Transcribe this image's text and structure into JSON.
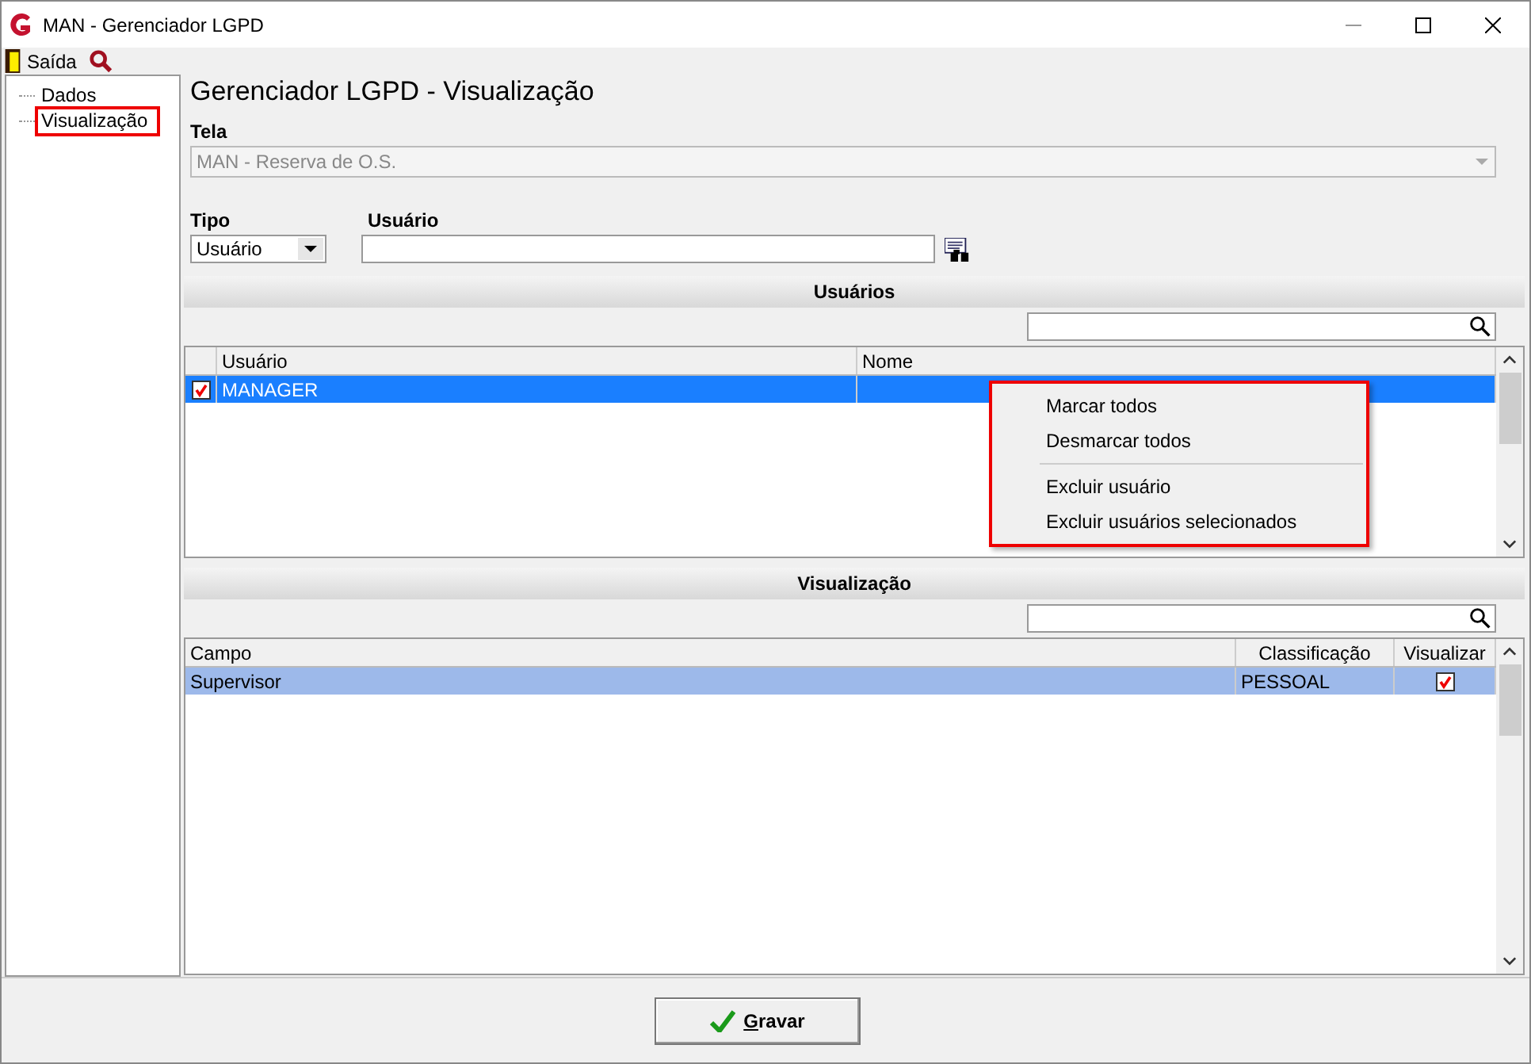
{
  "window": {
    "title": "MAN - Gerenciador LGPD"
  },
  "toolbar": {
    "exit_label": "Saída"
  },
  "tree": {
    "items": [
      {
        "label": "Dados",
        "selected": false
      },
      {
        "label": "Visualização",
        "selected": true
      }
    ]
  },
  "page_title": "Gerenciador LGPD - Visualização",
  "tela": {
    "label": "Tela",
    "value": "MAN - Reserva de O.S."
  },
  "tipo": {
    "label": "Tipo",
    "value": "Usuário"
  },
  "usuario": {
    "label": "Usuário"
  },
  "users_section": {
    "title": "Usuários",
    "columns": [
      "Usuário",
      "Nome"
    ],
    "rows": [
      {
        "checked": true,
        "selected": true,
        "cells": [
          "MANAGER",
          ""
        ]
      }
    ]
  },
  "context_menu": {
    "groups": [
      [
        "Marcar todos",
        "Desmarcar todos"
      ],
      [
        "Excluir usuário",
        "Excluir usuários selecionados"
      ]
    ]
  },
  "view_section": {
    "title": "Visualização",
    "columns": [
      "Campo",
      "Classificação",
      "Visualizar"
    ],
    "rows": [
      {
        "selected": true,
        "checked": true,
        "cells": [
          "Supervisor",
          "PESSOAL"
        ]
      }
    ]
  },
  "save_button": "Gravar"
}
